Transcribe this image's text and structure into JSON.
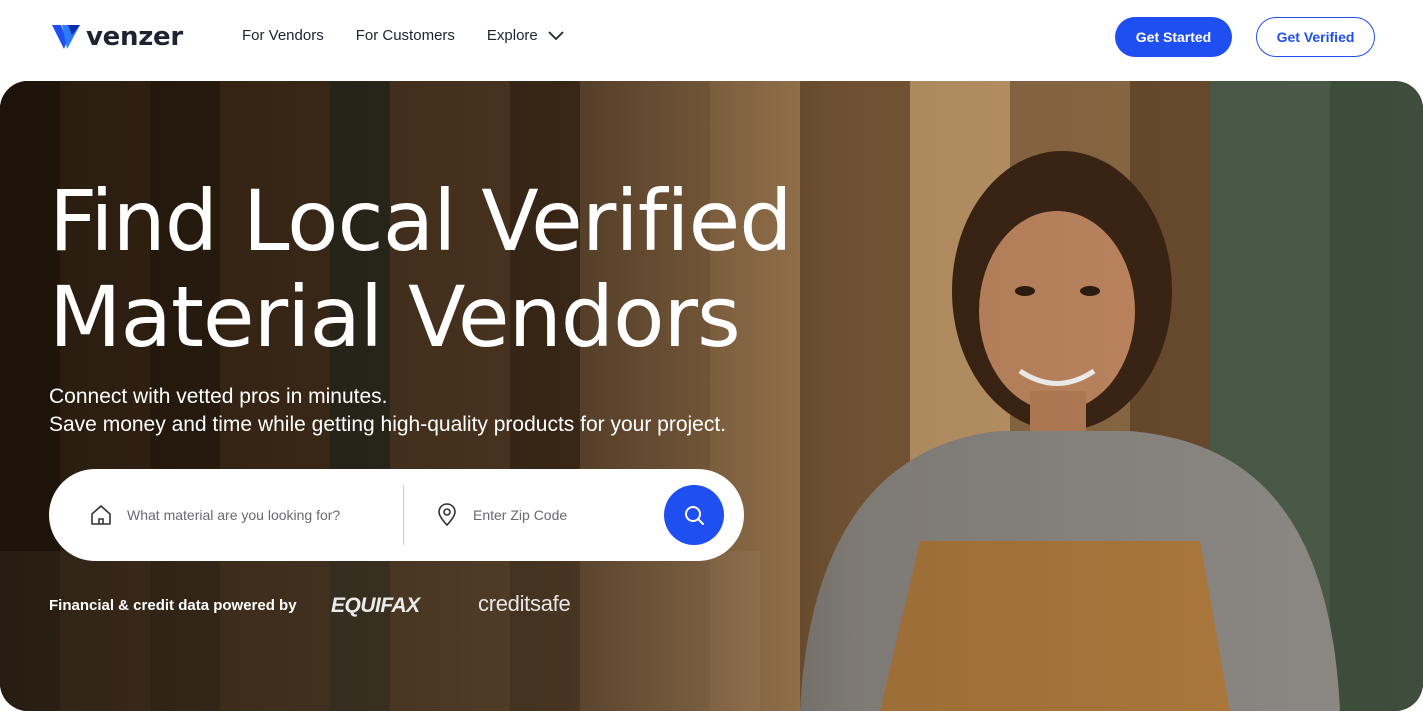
{
  "brand": {
    "name": "venzer",
    "accent": "#1f4ff0"
  },
  "nav": {
    "links": [
      {
        "label": "For Vendors"
      },
      {
        "label": "For Customers"
      },
      {
        "label": "Explore"
      }
    ],
    "get_started": "Get Started",
    "get_verified": "Get Verified"
  },
  "hero": {
    "title_line1": "Find Local Verified",
    "title_line2": "Material Vendors",
    "subtitle_line1": "Connect with vetted pros in minutes.",
    "subtitle_line2": "Save money and time while getting high-quality products for your project."
  },
  "search": {
    "material_placeholder": "What material are you looking for?",
    "zip_placeholder": "Enter Zip Code",
    "material_icon": "home-icon",
    "zip_icon": "map-pin-icon",
    "submit_icon": "search-icon"
  },
  "partners": {
    "label": "Financial & credit data powered by",
    "equifax": "EQUIFAX",
    "creditsafe": "creditsafe"
  }
}
